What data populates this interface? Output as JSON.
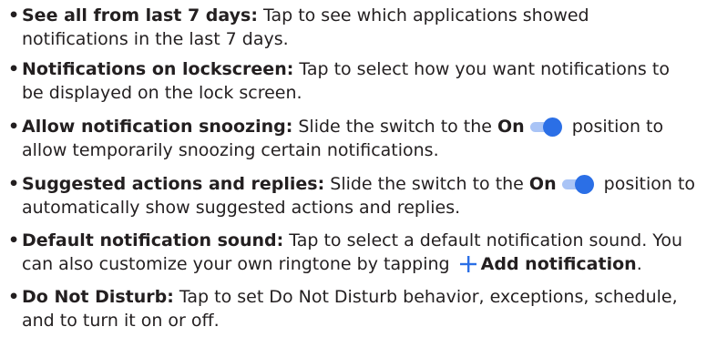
{
  "accent_color": "#2b6fe6",
  "toggle_track_color": "#a9c4f6",
  "items": [
    {
      "term": "See all from last 7 days:",
      "line1_rest": " Tap to see which applications showed",
      "line2": "notifications in the last 7 days."
    },
    {
      "term": "Notifications on lockscreen:",
      "line1_rest": " Tap to select how you want notifications to",
      "line2": "be displayed on the lock screen."
    },
    {
      "term": "Allow notification snoozing:",
      "line1_pre": " Slide the switch to the ",
      "on_label": "On",
      "line1_post": " position to",
      "line2": "allow temporarily snoozing certain notifications."
    },
    {
      "term": "Suggested actions and replies:",
      "line1_pre": " Slide the switch to the ",
      "on_label": "On",
      "line1_post": " position to",
      "line2": "automatically show suggested actions and replies."
    },
    {
      "term": "Default notification sound:",
      "line1_rest": " Tap to select a default notification sound. You",
      "line2_pre": "can also customize your own ringtone by tapping ",
      "add_label": "Add notification",
      "line2_post": "."
    },
    {
      "term": "Do Not Disturb:",
      "line1_rest": " Tap to set Do Not Disturb behavior, exceptions, schedule,",
      "line2": "and to turn it on or off."
    }
  ],
  "bullet": "•",
  "icons": {
    "toggle": "toggle-on-icon",
    "add": "plus-icon"
  }
}
